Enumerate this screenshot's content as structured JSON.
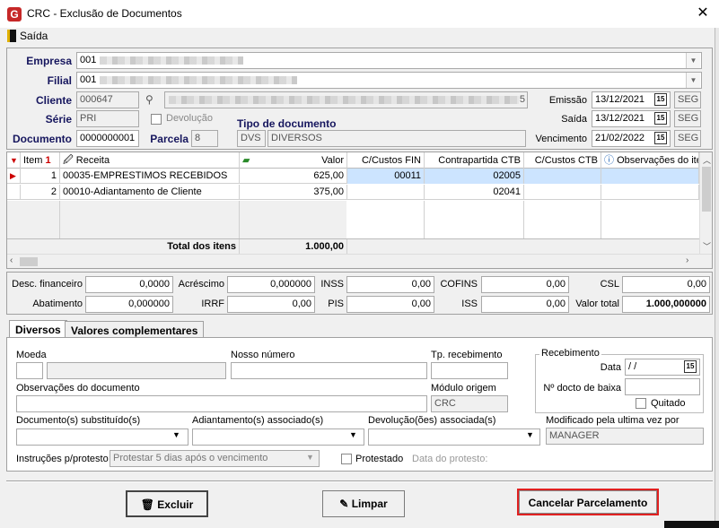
{
  "window": {
    "title": "CRC - Exclusão de Documentos",
    "close": "✕"
  },
  "menu": {
    "saida": "Saída"
  },
  "header": {
    "empresa_label": "Empresa",
    "empresa_code": "001",
    "filial_label": "Filial",
    "filial_code": "001",
    "cliente_label": "Cliente",
    "cliente_code": "000647",
    "serie_label": "Série",
    "serie_value": "PRI",
    "devolucao_label": "Devolução",
    "tipo_label": "Tipo de documento",
    "documento_label": "Documento",
    "documento_value": "0000000001",
    "parcela_label": "Parcela",
    "parcela_value": "8",
    "tipo_code": "DVS",
    "tipo_desc": "DIVERSOS",
    "emissao_label": "Emissão",
    "emissao_value": "13/12/2021",
    "emissao_day": "SEG",
    "saida_label": "Saída",
    "saida_value": "13/12/2021",
    "saida_day": "SEG",
    "vencimento_label": "Vencimento",
    "vencimento_value": "21/02/2022",
    "vencimento_day": "SEG",
    "cliente_suffix": "5"
  },
  "grid": {
    "columns": [
      "Item",
      "Receita",
      "Valor",
      "C/Custos FIN",
      "Contrapartida CTB",
      "C/Custos CTB",
      "Observações do ite"
    ],
    "rows": [
      {
        "item": "1",
        "receita": "00035-EMPRESTIMOS RECEBIDOS",
        "valor": "625,00",
        "ccfin": "00011",
        "contra": "02005",
        "ccctb": "",
        "obs": ""
      },
      {
        "item": "2",
        "receita": "00010-Adiantamento de Cliente",
        "valor": "375,00",
        "ccfin": "",
        "contra": "02041",
        "ccctb": "",
        "obs": ""
      }
    ],
    "total_label": "Total dos itens",
    "total_value": "1.000,00"
  },
  "taxes": {
    "desc_fin_label": "Desc. financeiro",
    "desc_fin": "0,0000",
    "acrescimo_label": "Acréscimo",
    "acrescimo": "0,000000",
    "inss_label": "INSS",
    "inss": "0,00",
    "cofins_label": "COFINS",
    "cofins": "0,00",
    "csl_label": "CSL",
    "csl": "0,00",
    "abatimento_label": "Abatimento",
    "abatimento": "0,000000",
    "irrf_label": "IRRF",
    "irrf": "0,00",
    "pis_label": "PIS",
    "pis": "0,00",
    "iss_label": "ISS",
    "iss": "0,00",
    "valor_total_label": "Valor total",
    "valor_total": "1.000,000000"
  },
  "tabs": {
    "diversos": "Diversos",
    "valores": "Valores complementares"
  },
  "diversos": {
    "moeda_label": "Moeda",
    "nosso_numero_label": "Nosso número",
    "tp_recebimento_label": "Tp. recebimento",
    "recebimento_group": "Recebimento",
    "data_label": "Data",
    "data_value": " /  /",
    "n_docto_label": "Nº docto de baixa",
    "quitado_label": "Quitado",
    "obs_label": "Observações do documento",
    "modulo_label": "Módulo origem",
    "modulo_value": "CRC",
    "doc_subst_label": "Documento(s) substituído(s)",
    "adiant_label": "Adiantamento(s) associado(s)",
    "devol_label": "Devolução(ões) associada(s)",
    "modificado_label": "Modificado pela ultima vez por",
    "modificado_value": "MANAGER",
    "instrucoes_label": "Instruções p/protesto",
    "instrucoes_value": "Protestar 5 dias após o vencimento",
    "protestado_label": "Protestado",
    "data_protesto_label": "Data do protesto:"
  },
  "buttons": {
    "excluir": "Excluir",
    "limpar": "Limpar",
    "cancelar": "Cancelar Parcelamento"
  },
  "colors": {
    "highlight_border": "#e02020",
    "selected_row": "#cce4ff",
    "label_blue": "#16165e"
  }
}
